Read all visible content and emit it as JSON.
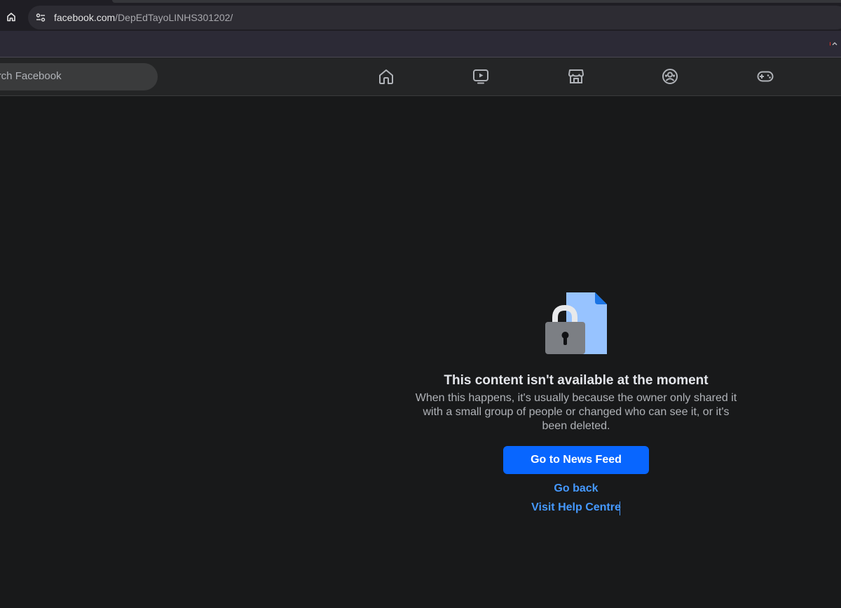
{
  "browser": {
    "url_host": "facebook.com",
    "url_path": "/DepEdTayoLINHS301202/",
    "home_icon": "home-icon",
    "site_info_icon": "tune-icon"
  },
  "header": {
    "search_placeholder": "Search Facebook",
    "nav": [
      {
        "name": "home",
        "icon": "home-icon"
      },
      {
        "name": "video",
        "icon": "video-icon"
      },
      {
        "name": "marketplace",
        "icon": "marketplace-icon"
      },
      {
        "name": "groups",
        "icon": "groups-icon"
      },
      {
        "name": "gaming",
        "icon": "gaming-icon"
      }
    ]
  },
  "main": {
    "title": "This content isn't available at the moment",
    "description": "When this happens, it's usually because the owner only shared it with a small group of people or changed who can see it, or it's been deleted.",
    "primary_button": "Go to News Feed",
    "go_back": "Go back",
    "help": "Visit Help Centre"
  },
  "colors": {
    "page_bg": "#18191a",
    "header_bg": "#242526",
    "primary": "#0866ff",
    "link": "#4599ff"
  }
}
